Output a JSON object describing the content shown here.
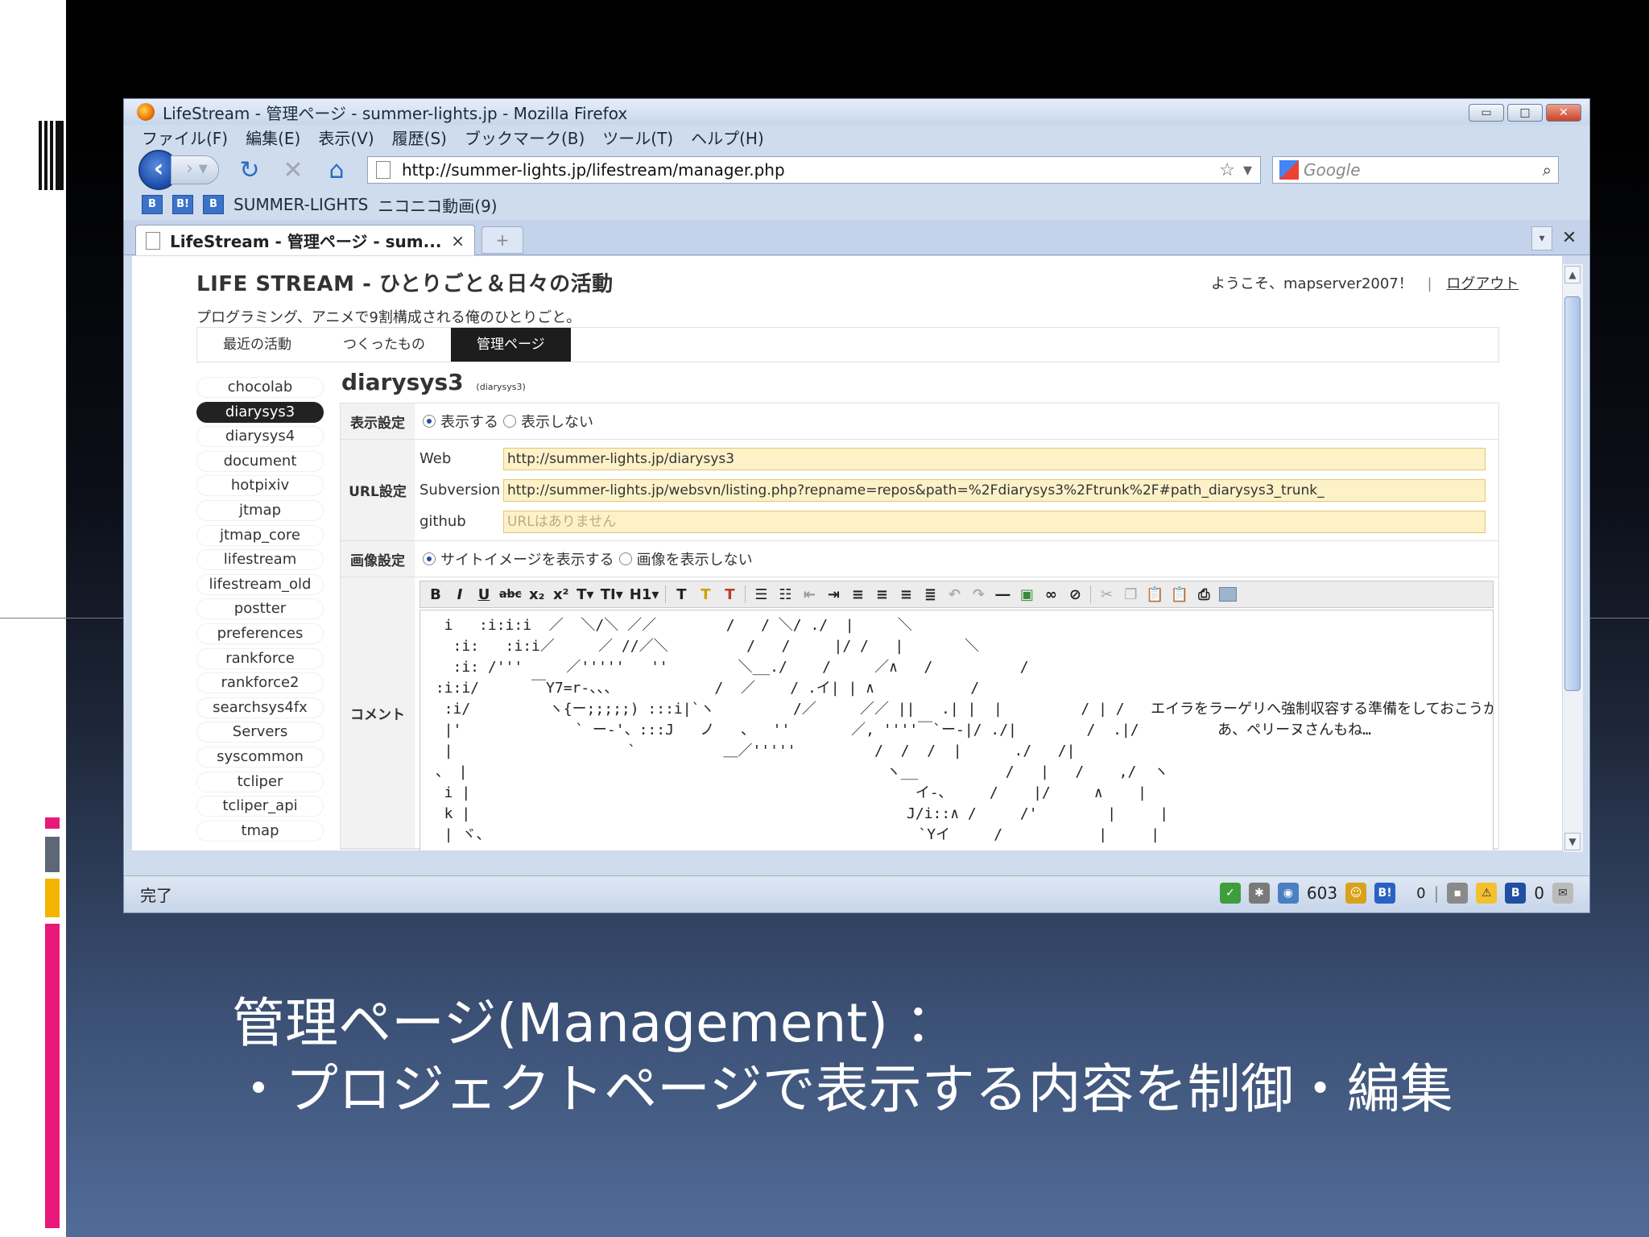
{
  "window": {
    "title": "LifeStream - 管理ページ - summer-lights.jp - Mozilla Firefox"
  },
  "menubar": [
    "ファイル(F)",
    "編集(E)",
    "表示(V)",
    "履歴(S)",
    "ブックマーク(B)",
    "ツール(T)",
    "ヘルプ(H)"
  ],
  "navbar": {
    "url": "http://summer-lights.jp/lifestream/manager.php",
    "search_placeholder": "Google"
  },
  "bookmarks": {
    "item1": "SUMMER-LIGHTS",
    "item2": "ニコニコ動画(9)"
  },
  "tab": {
    "label": "LifeStream - 管理ページ - sum...",
    "close": "×"
  },
  "page": {
    "site_title": "LIFE STREAM - ひとりごと＆日々の活動",
    "welcome": "ようこそ、mapserver2007！",
    "logout": "ログアウト",
    "subtitle": "プログラミング、アニメで9割構成される俺のひとりごと。",
    "nav_tabs": [
      "最近の活動",
      "つくったもの",
      "管理ページ"
    ],
    "projects": [
      "chocolab",
      "diarysys3",
      "diarysys4",
      "document",
      "hotpixiv",
      "jtmap",
      "jtmap_core",
      "lifestream",
      "lifestream_old",
      "postter",
      "preferences",
      "rankforce",
      "rankforce2",
      "searchsys4fx",
      "Servers",
      "syscommon",
      "tcliper",
      "tcliper_api",
      "tmap"
    ],
    "project_title": "diarysys3",
    "project_title_small": "(diarysys3)",
    "display_label": "表示設定",
    "display_show": "表示する",
    "display_hide": "表示しない",
    "url_label": "URL設定",
    "web_label": "Web",
    "web_value": "http://summer-lights.jp/diarysys3",
    "svn_label": "Subversion",
    "svn_value": "http://summer-lights.jp/websvn/listing.php?repname=repos&path=%2Fdiarysys3%2Ftrunk%2F#path_diarysys3_trunk_",
    "github_label": "github",
    "github_placeholder": "URLはありません",
    "image_label": "画像設定",
    "image_show": "サイトイメージを表示する",
    "image_hide": "画像を表示しない",
    "comment_label": "コメント"
  },
  "editor": {
    "toolbar": [
      "B",
      "I",
      "U",
      "abc",
      "x₂",
      "x²",
      "T▾",
      "TI▾",
      "H1▾"
    ],
    "art": [
      "  i   :i:i:i  ／  ＼/＼ ／／        /   / ＼/ ./  |     ＼",
      "   :i:   :i:i／     ／ //／＼         /   /     |/ /   |       ＼",
      "   :i: /'''     ／'''''   ''        ＼__./    /     ／∧   /          /",
      " :i:i/      ￣Y7=r-、、、           /  ／    / .イ| | ∧           /",
      "  :i/         ヽ{ー;;;;;) :::i|`ヽ         /／     ／／ ||   .| |  |         / | /   エイラをラーゲリへ強制収容する準備をしておこうかな",
      "  |'             ` ー-'、:::J   ノ   、  ''       ／, ''''￣`ー-|/ ./|        /  .|/         あ、ペリーヌさんもね…",
      "  |                    `          ＿／'''''         /  /  /  |      ./   /|",
      " 、 |                                                ヽ__          /   |   /    ,/  ヽ",
      "  i |                                                   イ‐､     /    |/     ∧    |",
      "  k |                                                  J/i::∧ /     /'        |     |",
      "  | ヾ、                                                 `Yイ     /           |     |"
    ],
    "art_tops": [
      0,
      0,
      0,
      0,
      0,
      0,
      0,
      0,
      0,
      0,
      0
    ]
  },
  "status": {
    "text": "完了",
    "count1": "603",
    "count2": "0",
    "count3": "0"
  },
  "caption": {
    "line1": "管理ページ(Management) ：",
    "line2": "・プロジェクトページで表示する内容を制御・編集"
  },
  "colors": {
    "accent_pink": "#e8197a",
    "accent_yellow": "#f4b400",
    "accent_gray": "#5d6775",
    "url_field_bg": "#fdf1c8"
  }
}
